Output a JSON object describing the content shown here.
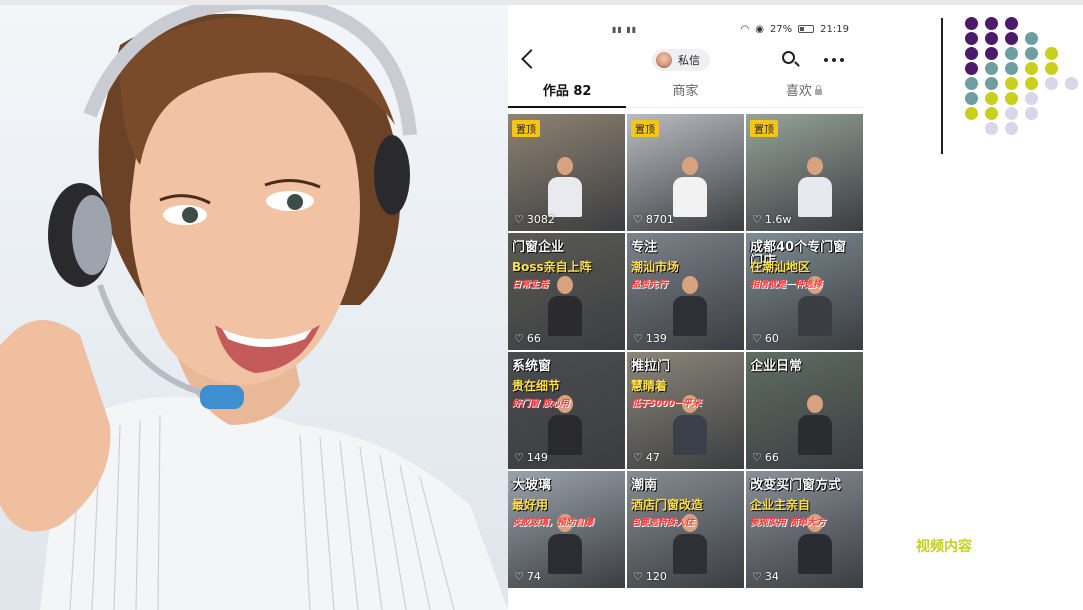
{
  "phone": {
    "status": {
      "battery": "27%",
      "time": "21:19"
    },
    "nav": {
      "dm_label": "私信"
    },
    "tabs": [
      {
        "label": "作品 82"
      },
      {
        "label": "商家"
      },
      {
        "label": "喜欢"
      }
    ],
    "tiles": [
      {
        "pin": "置顶",
        "likes": "3082",
        "cap1": "",
        "cap2": "",
        "cap3": "",
        "scene": "#8f8372"
      },
      {
        "pin": "置顶",
        "likes": "8701",
        "cap1": "",
        "cap2": "",
        "cap3": "",
        "scene": "#b9bdc2"
      },
      {
        "pin": "置顶",
        "likes": "1.6w",
        "cap1": "",
        "cap2": "",
        "cap3": "",
        "scene": "#96a39a"
      },
      {
        "pin": "",
        "likes": "66",
        "cap1": "门窗企业",
        "cap2": "Boss亲自上阵",
        "cap3": "日常生活",
        "scene": "#5b5a55"
      },
      {
        "pin": "",
        "likes": "139",
        "cap1": "专注",
        "cap2": "潮汕市场",
        "cap3": "品质先行",
        "scene": "#7c838a"
      },
      {
        "pin": "",
        "likes": "60",
        "cap1": "成都40个专门窗门店",
        "cap2": "在潮汕地区",
        "cap3": "相信就是一种选择",
        "scene": "#7d8c93"
      },
      {
        "pin": "",
        "likes": "149",
        "cap1": "系统窗",
        "cap2": "贵在细节",
        "cap3": "好门窗 放心用",
        "scene": "#4a4c4f"
      },
      {
        "pin": "",
        "likes": "47",
        "cap1": "推拉门",
        "cap2": "慧睛着",
        "cap3": "低于5000一平米",
        "scene": "#8b8679"
      },
      {
        "pin": "",
        "likes": "66",
        "cap1": "企业日常",
        "cap2": "",
        "cap3": "",
        "scene": "#5f6d63"
      },
      {
        "pin": "",
        "likes": "74",
        "cap1": "大玻璃",
        "cap2": "最好用",
        "cap3": "夹胶玻璃，预防自爆",
        "scene": "#9aa3ad"
      },
      {
        "pin": "",
        "likes": "120",
        "cap1": "潮南",
        "cap2": "酒店门窗改造",
        "cap3": "色要选特殊入住",
        "scene": "#858d93"
      },
      {
        "pin": "",
        "likes": "34",
        "cap1": "改变买门窗方式",
        "cap2": "企业主亲自",
        "cap3": "美观实用 简单大方",
        "scene": "#8a9099"
      }
    ]
  },
  "caption": "视频内容",
  "colors": {
    "purple": "#4b1a6b",
    "teal": "#6f9ea0",
    "lime": "#c9cf1e",
    "lavender": "#d8d6e8"
  }
}
